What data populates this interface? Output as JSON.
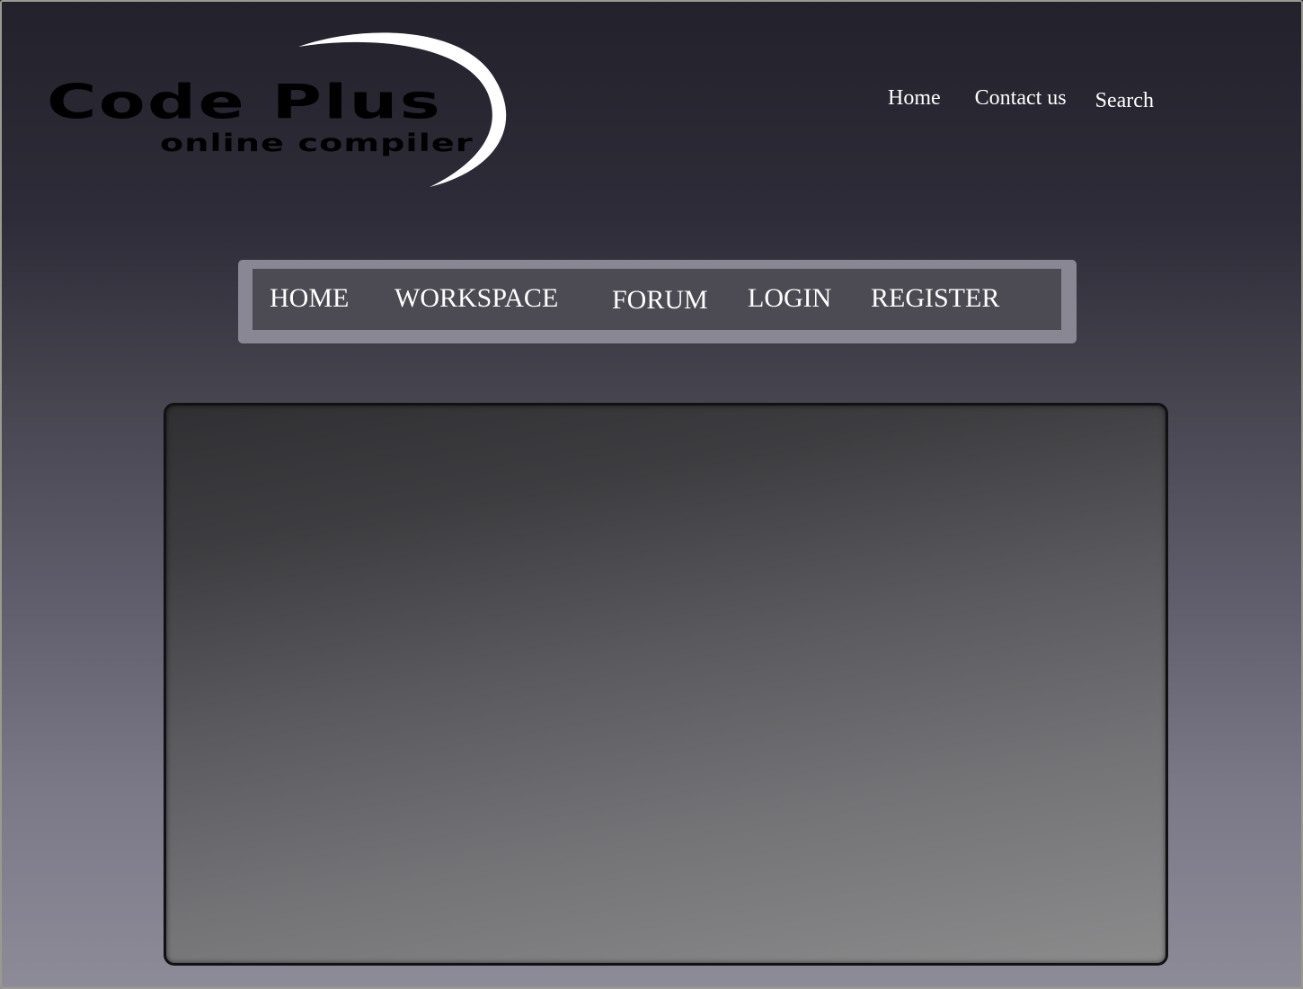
{
  "logo": {
    "title": "Code Plus",
    "subtitle": "online compiler"
  },
  "top_links": {
    "home": "Home",
    "contact": "Contact us",
    "search": "Search"
  },
  "nav": {
    "items": [
      "HOME",
      "WORKSPACE",
      "FORUM",
      "LOGIN",
      "REGISTER"
    ]
  },
  "colors": {
    "background_top": "#23212b",
    "background_bottom": "#8d8b98",
    "nav_frame": "#8a8794",
    "nav_bar": "#4c4a52",
    "panel_dark": "#303033",
    "panel_light": "#8b8b8c",
    "text": "#ffffff"
  }
}
